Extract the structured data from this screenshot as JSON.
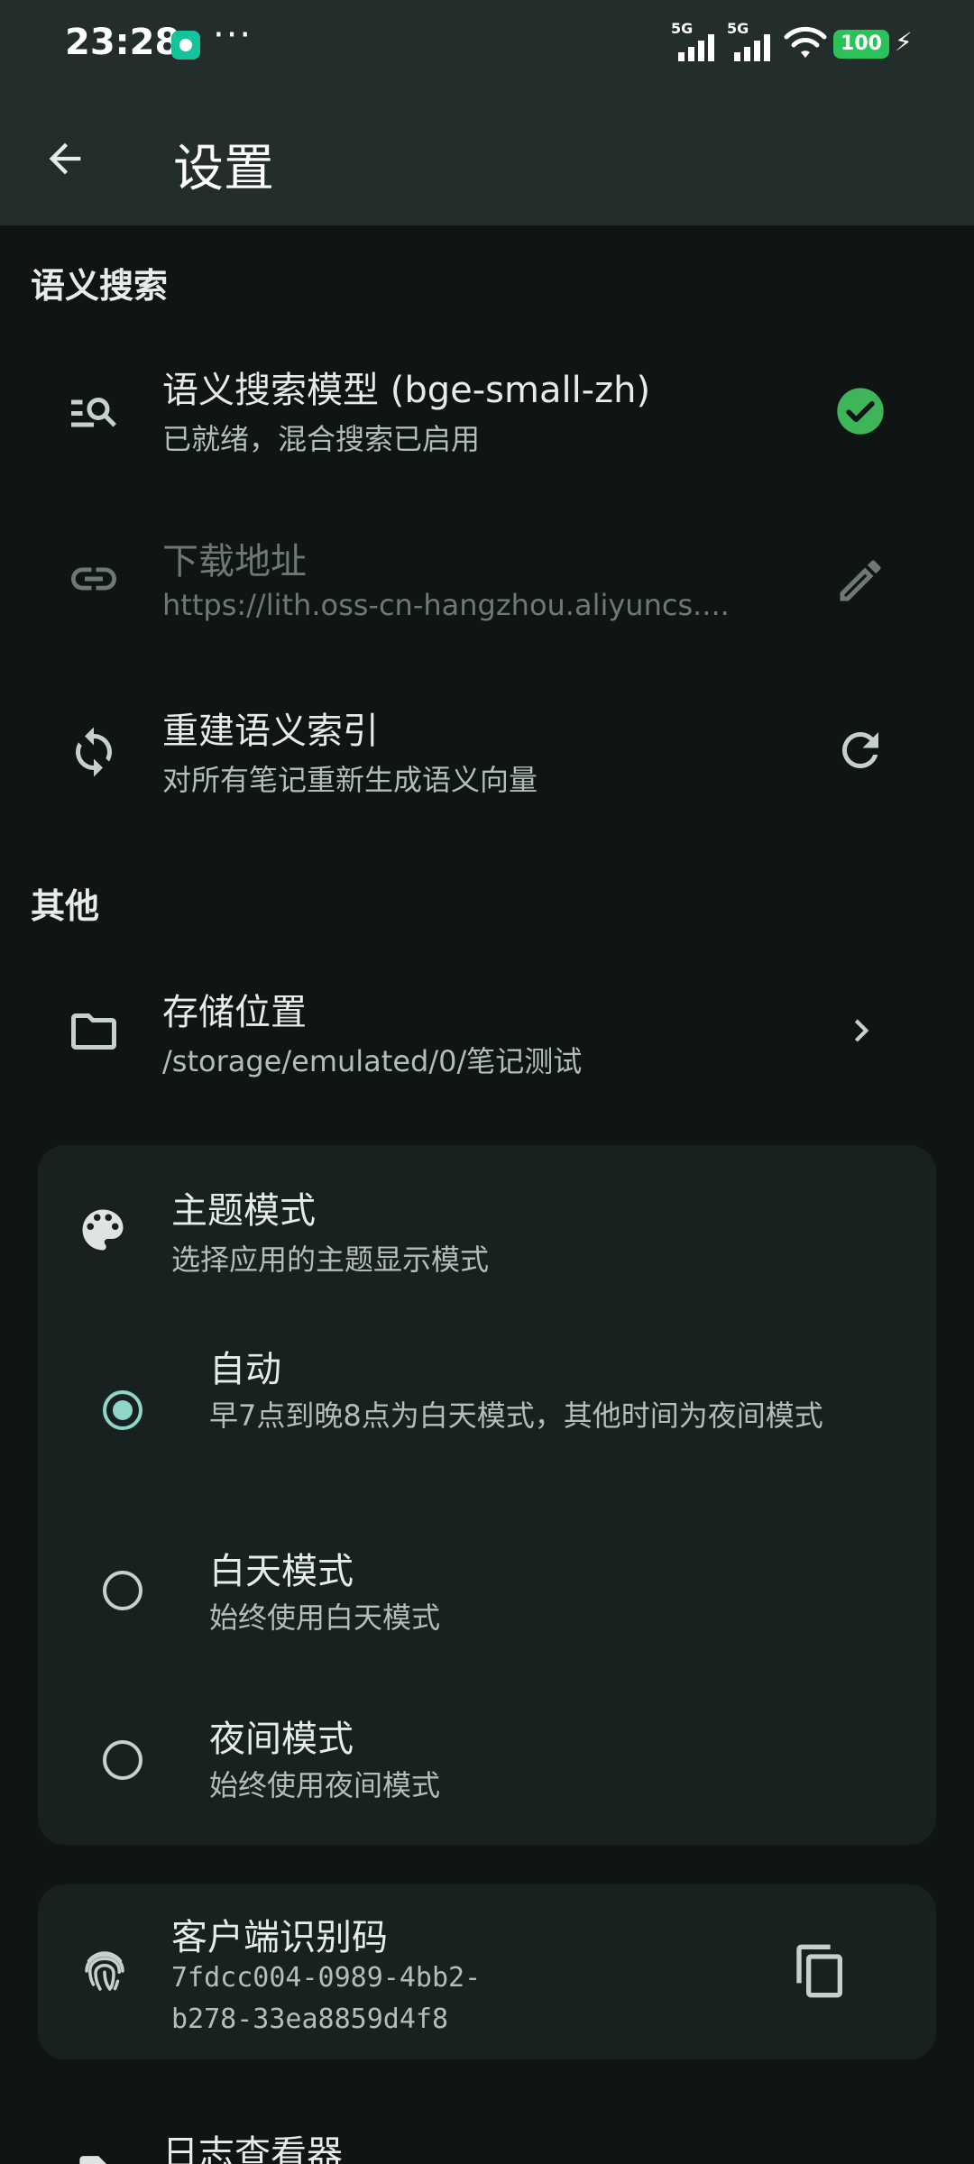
{
  "status_bar": {
    "time": "23:28",
    "more": "···",
    "network_1": "5G",
    "network_2": "5G",
    "battery": "100"
  },
  "app_bar": {
    "title": "设置"
  },
  "semantic_search": {
    "header": "语义搜索",
    "model": {
      "title": "语义搜索模型 (bge-small-zh)",
      "subtitle": "已就绪，混合搜索已启用"
    },
    "download": {
      "title": "下载地址",
      "subtitle": "https://lith.oss-cn-hangzhou.aliyuncs...."
    },
    "rebuild": {
      "title": "重建语义索引",
      "subtitle": "对所有笔记重新生成语义向量"
    }
  },
  "other": {
    "header": "其他",
    "storage": {
      "title": "存储位置",
      "subtitle": "/storage/emulated/0/笔记测试"
    },
    "theme": {
      "title": "主题模式",
      "subtitle": "选择应用的主题显示模式",
      "options": [
        {
          "title": "自动",
          "subtitle": "早7点到晚8点为白天模式，其他时间为夜间模式",
          "selected": true
        },
        {
          "title": "白天模式",
          "subtitle": "始终使用白天模式",
          "selected": false
        },
        {
          "title": "夜间模式",
          "subtitle": "始终使用夜间模式",
          "selected": false
        }
      ]
    },
    "client_id": {
      "title": "客户端识别码",
      "line1": "7fdcc004-0989-4bb2-",
      "line2": "b278-33ea8859d4f8"
    },
    "log_viewer": {
      "title": "日志查看器"
    }
  },
  "colors": {
    "accent": "#8fd5c8",
    "success": "#3fb55a",
    "background": "#0f1514",
    "card": "#182120"
  }
}
